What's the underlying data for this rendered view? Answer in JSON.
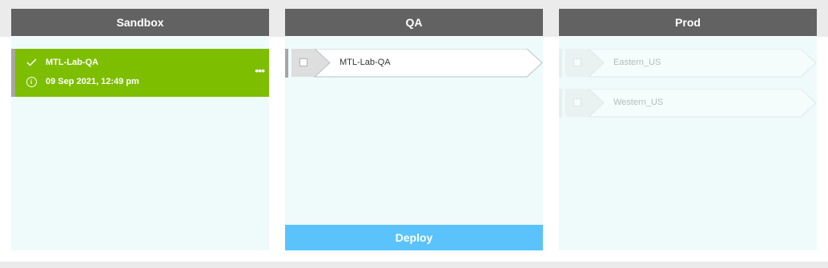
{
  "columns": {
    "sandbox": {
      "title": "Sandbox",
      "card": {
        "name": "MTL-Lab-QA",
        "timestamp": "09 Sep 2021, 12:49 pm",
        "status_icon": "check-icon",
        "info_icon": "info-icon",
        "more_label": "•••"
      }
    },
    "qa": {
      "title": "QA",
      "items": [
        {
          "label": "MTL-Lab-QA",
          "checked": false,
          "enabled": true
        }
      ],
      "deploy_label": "Deploy"
    },
    "prod": {
      "title": "Prod",
      "items": [
        {
          "label": "Eastern_US",
          "checked": false,
          "enabled": false
        },
        {
          "label": "Western_US",
          "checked": false,
          "enabled": false
        }
      ]
    }
  },
  "colors": {
    "header_bg": "#626262",
    "column_bg": "#effbfb",
    "card_success": "#7dbe00",
    "deploy_button": "#5bc3fb",
    "stripe": "#a6a6a6"
  }
}
